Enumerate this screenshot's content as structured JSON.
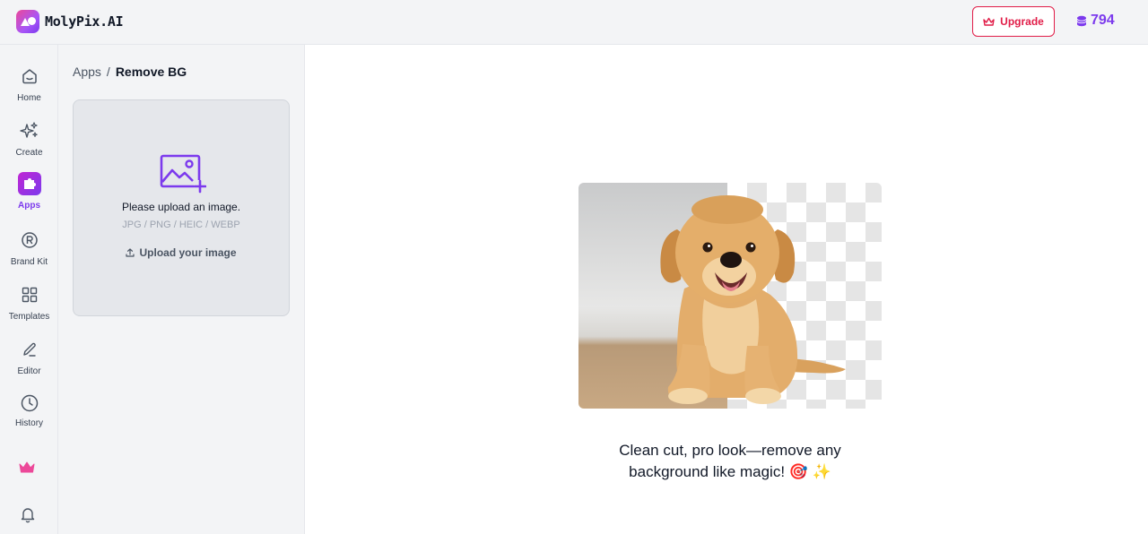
{
  "app": {
    "name": "MolyPix.AI"
  },
  "header": {
    "upgrade_label": "Upgrade",
    "credits": "794"
  },
  "rail": {
    "items": [
      {
        "label": "Home",
        "icon": "home-icon"
      },
      {
        "label": "Create",
        "icon": "sparkles-icon"
      },
      {
        "label": "Apps",
        "icon": "puzzle-icon"
      },
      {
        "label": "Brand Kit",
        "icon": "registered-icon"
      },
      {
        "label": "Templates",
        "icon": "grid-icon"
      },
      {
        "label": "Editor",
        "icon": "pencil-icon"
      },
      {
        "label": "History",
        "icon": "clock-icon"
      }
    ],
    "bottom": [
      {
        "icon": "crown-icon",
        "color": "#ec4899"
      },
      {
        "icon": "bell-icon"
      }
    ]
  },
  "breadcrumb": {
    "parent": "Apps",
    "separator": "/",
    "current": "Remove BG"
  },
  "upload": {
    "title": "Please upload an image.",
    "formats": "JPG / PNG / HEIC / WEBP",
    "link_label": "Upload your image"
  },
  "main": {
    "tagline_line1": "Clean cut, pro look—remove any",
    "tagline_line2": "background like magic! 🎯 ✨"
  },
  "colors": {
    "accent": "#7c3aed",
    "upgrade": "#e11d48"
  }
}
